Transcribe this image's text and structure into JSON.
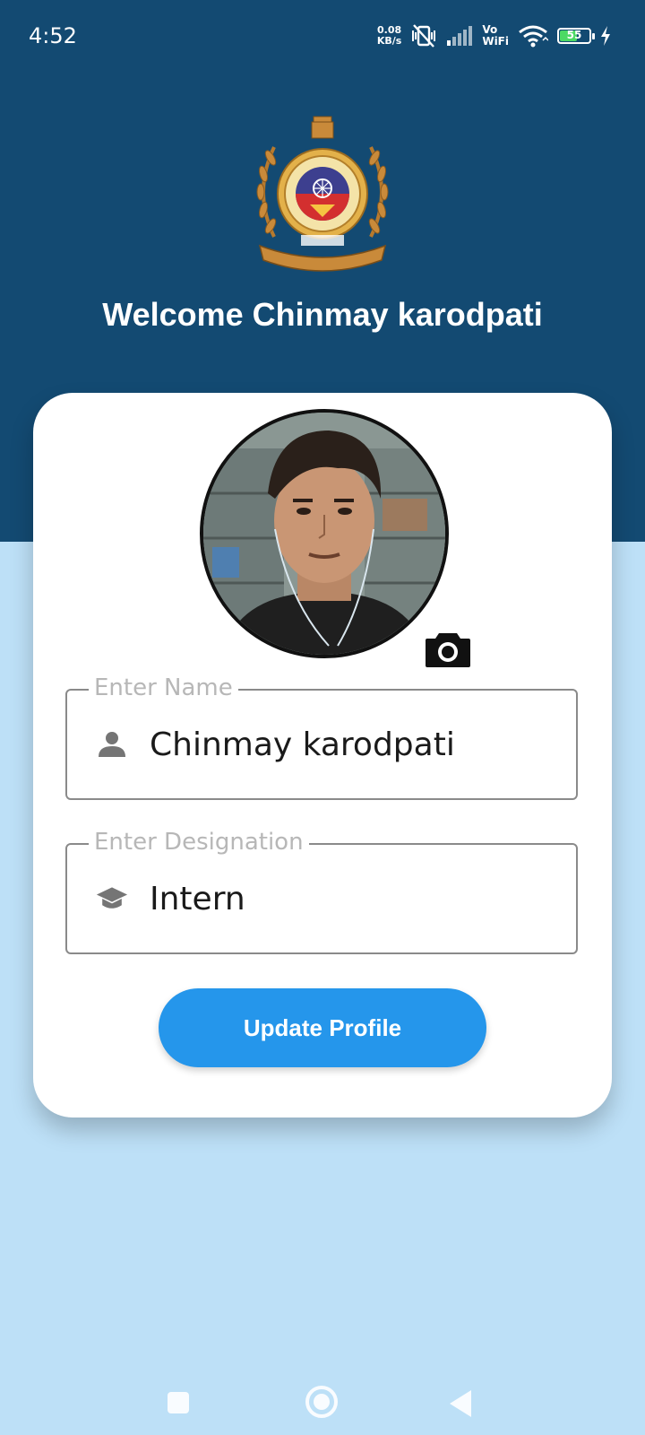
{
  "status_bar": {
    "time": "4:52",
    "net_speed_value": "0.08",
    "net_speed_unit": "KB/s",
    "vowifi_top": "Vo",
    "vowifi_bottom": "WiFi",
    "battery_level": "55",
    "icons": [
      "vibrate-off-icon",
      "cellular-signal-icon",
      "wifi-icon",
      "battery-icon",
      "charging-bolt-icon"
    ]
  },
  "header": {
    "emblem": "institute-emblem",
    "welcome_text": "Welcome Chinmay karodpati"
  },
  "profile": {
    "photo": "profile-photo",
    "camera_icon": "camera-icon"
  },
  "form": {
    "name_label": "Enter Name",
    "name_value": "Chinmay karodpati",
    "name_icon": "person-icon",
    "designation_label": "Enter Designation",
    "designation_value": "Intern",
    "designation_icon": "graduation-cap-icon",
    "update_button": "Update Profile"
  },
  "nav_bar": {
    "buttons": [
      "recents-square-icon",
      "home-circle-icon",
      "back-triangle-icon"
    ]
  },
  "colors": {
    "header_background": "#134a72",
    "page_background": "#bde0f7",
    "card_background": "#ffffff",
    "button_background": "#2596eb",
    "button_text": "#ffffff"
  }
}
